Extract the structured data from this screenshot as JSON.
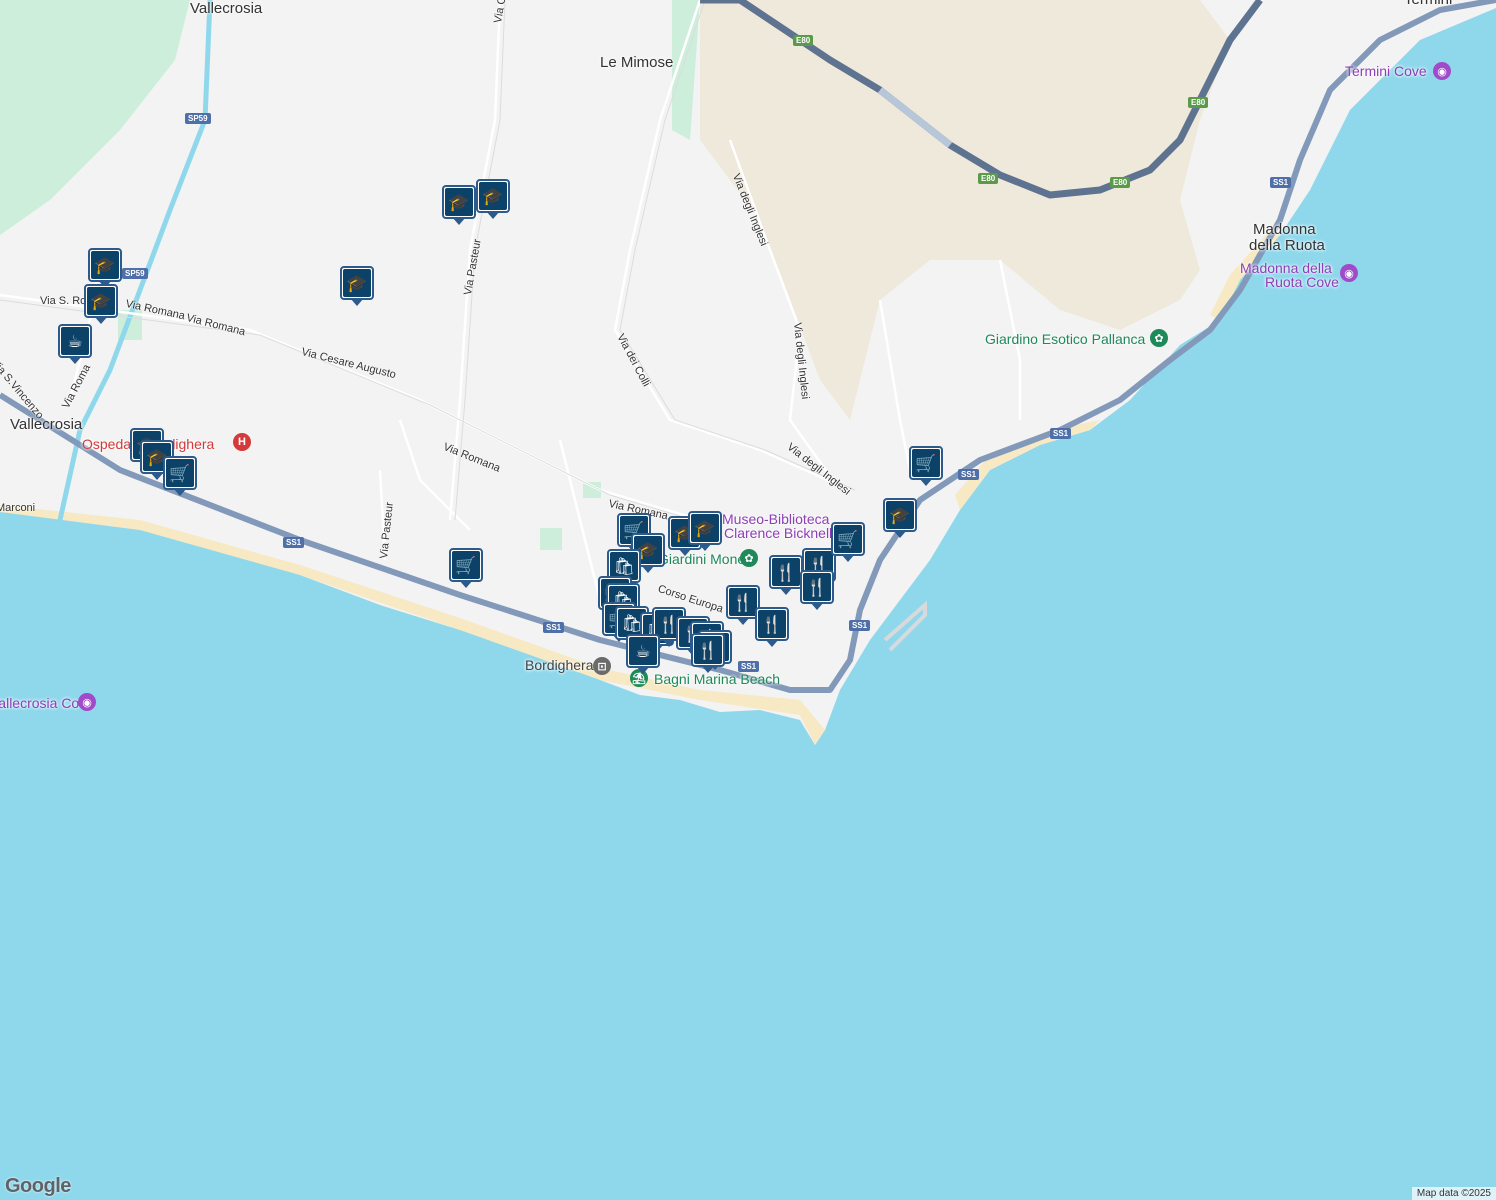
{
  "colors": {
    "water": "#8fd8ec",
    "land": "#f3f3f4",
    "hills": "#efe9dc",
    "park": "#cdeedb",
    "beach": "#f6e9c3",
    "road_major": "#8299b9",
    "motorway": "#5e7390",
    "marker_border": "#2c5a8a",
    "marker_fill": "#0c4168"
  },
  "places": {
    "vallecrosia_top": "Vallecrosia",
    "le_mimose": "Le Mimose",
    "vallecrosia": "Vallecrosia",
    "madonna_della_ruota_1": "Madonna",
    "madonna_della_ruota_2": "della Ruota",
    "termini": "Termini",
    "bordighera": "Bordighera"
  },
  "pois": {
    "termini_cove": "Termini Cove",
    "madonna_cove_1": "Madonna della",
    "madonna_cove_2": "Ruota Cove",
    "giardino": "Giardino Esotico Pallanca",
    "museo_1": "Museo-Biblioteca",
    "museo_2": "Clarence Bicknell\"",
    "giardini_monet": "Giardini Monet",
    "bagni": "Bagni Marina Beach",
    "ospedale": "Ospedale Bordighera",
    "vallecrosia_cove": "Vallecrosia Cove"
  },
  "streets": {
    "via_goffredo": "Via Goffredo",
    "via_pasteur_top": "Via Pasteur",
    "via_pasteur_bottom": "Via Pasteur",
    "via_s_ro": "Via S. Ro",
    "via_romana_1": "Via Romana",
    "via_romana_2": "Via Romana",
    "via_romana_3": "Via Romana",
    "via_romana_4": "Via Romana",
    "via_roma": "Via Roma",
    "via_s_vincenzo": "Via S.Vincenzo",
    "via_cesare_augusto": "Via Cesare Augusto",
    "via_dei_colli": "Via dei Colli",
    "via_degli_inglesi_1": "Via degli Inglesi",
    "via_degli_inglesi_2": "Via degli Inglesi",
    "via_degli_inglesi_3": "Via degli Inglesi",
    "corso_europa": "Corso Europa",
    "marconi": "Marconi"
  },
  "shields": {
    "e80_1": "E80",
    "e80_2": "E80",
    "e80_3": "E80",
    "e80_4": "E80",
    "ss1_1": "SS1",
    "ss1_2": "SS1",
    "ss1_3": "SS1",
    "ss1_4": "SS1",
    "ss1_5": "SS1",
    "ss1_6": "SS1",
    "ss1_7": "SS1",
    "sp59_1": "SP59",
    "sp59_2": "SP59"
  },
  "marker_icons": {
    "school": "graduation-cap-icon",
    "grocery": "shopping-cart-icon",
    "restaurant": "fork-knife-icon",
    "cafe": "coffee-cup-icon",
    "shopping": "shopping-bag-icon"
  },
  "footer": {
    "logo": "Google",
    "attribution": "Map data ©2025"
  }
}
